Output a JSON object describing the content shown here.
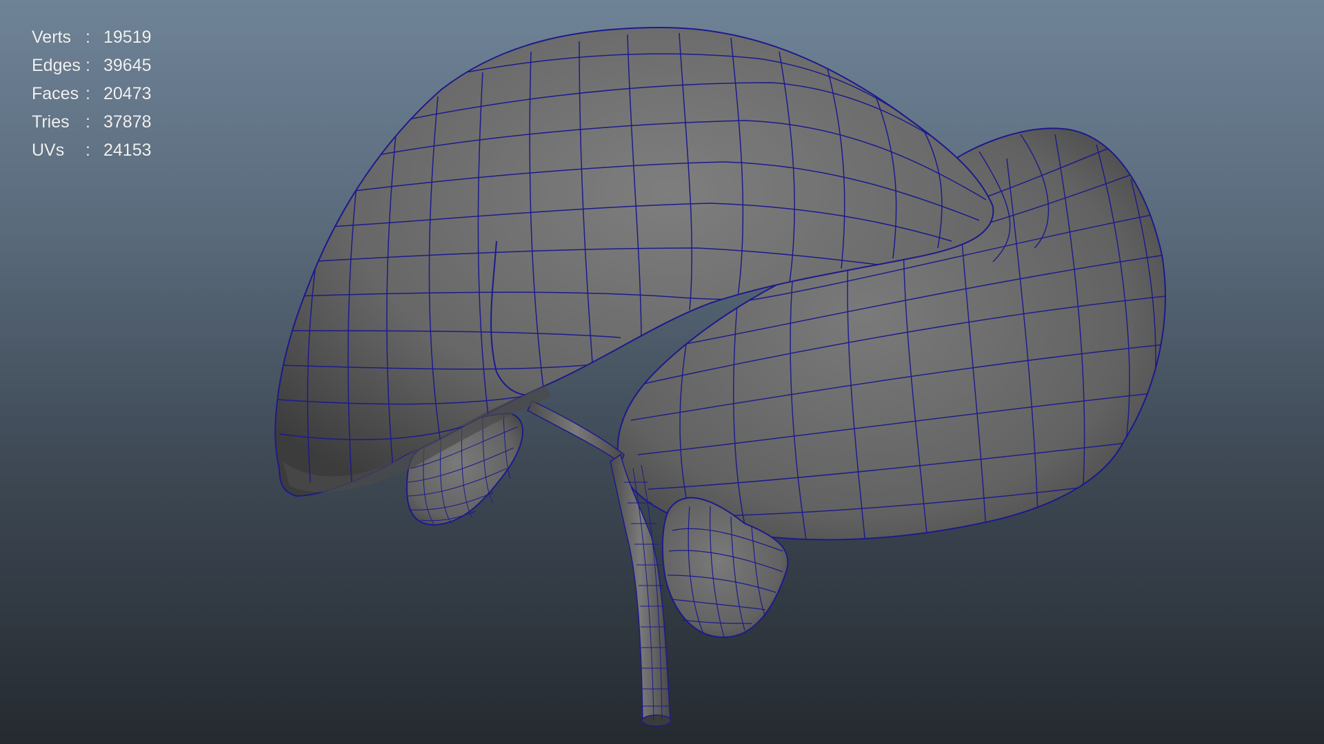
{
  "hud": {
    "stats": [
      {
        "label": "Verts",
        "sep": ":",
        "value": "19519"
      },
      {
        "label": "Edges",
        "sep": ":",
        "value": "39645"
      },
      {
        "label": "Faces",
        "sep": ":",
        "value": "20473"
      },
      {
        "label": "Tries",
        "sep": ":",
        "value": "37878"
      },
      {
        "label": "UVs",
        "sep": ":",
        "value": "24153"
      }
    ]
  },
  "viewport": {
    "background_top": "#6f8397",
    "background_bottom": "#252a30",
    "wireframe_color": "#1c1a8c",
    "mesh_color": "#6b6b6b"
  }
}
